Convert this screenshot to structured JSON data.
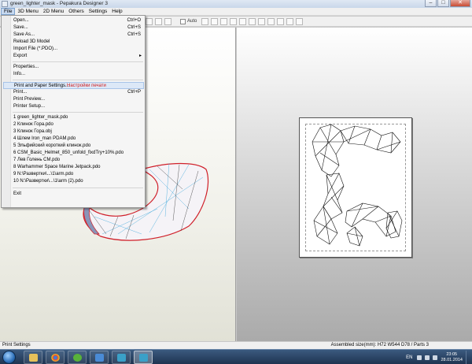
{
  "window": {
    "title": "green_lighter_mask - Pepakura Designer 3"
  },
  "menubar": [
    "File",
    "3D Menu",
    "2D Menu",
    "Others",
    "Settings",
    "Help"
  ],
  "toolbar": {
    "auto_label": "Auto"
  },
  "file_menu": {
    "groups": [
      [
        {
          "label": "Open...",
          "shortcut": "Ctrl+O"
        },
        {
          "label": "Save...",
          "shortcut": "Ctrl+S"
        },
        {
          "label": "Save As...",
          "shortcut": "Ctrl+S"
        },
        {
          "label": "Reload 3D Model",
          "shortcut": ""
        },
        {
          "label": "Import File (*.PDO)...",
          "shortcut": ""
        },
        {
          "label": "Export",
          "shortcut": "",
          "submenu": true
        }
      ],
      [
        {
          "label": "Properties...",
          "shortcut": ""
        },
        {
          "label": "Info...",
          "shortcut": ""
        }
      ],
      [
        {
          "label": "Print and Paper Settings...",
          "shortcut": "",
          "highlight": true,
          "note": "Настройки печати"
        },
        {
          "label": "Print...",
          "shortcut": "Ctrl+P"
        },
        {
          "label": "Print Preview...",
          "shortcut": ""
        },
        {
          "label": "Printer Setup...",
          "shortcut": ""
        }
      ],
      [
        {
          "label": "1 green_lighter_mask.pdo",
          "shortcut": ""
        },
        {
          "label": "2 Клинок Гора.pdo",
          "shortcut": ""
        },
        {
          "label": "3 Клинок Гора.obj",
          "shortcut": ""
        },
        {
          "label": "4 Шлем Iron_man PDAM.pdo",
          "shortcut": ""
        },
        {
          "label": "5 Эльфийский короткий клинок.pdo",
          "shortcut": ""
        },
        {
          "label": "6 CSM_Basic_Helmet_850_unfold_fixdTry+10%.pdo",
          "shortcut": ""
        },
        {
          "label": "7 Лев Голень CM.pdo",
          "shortcut": ""
        },
        {
          "label": "8 Warhammer Space Marine Jetpack.pdo",
          "shortcut": ""
        },
        {
          "label": "9 N:\\Развертки\\...\\1\\arm.pdo",
          "shortcut": ""
        },
        {
          "label": "10 N:\\Развертки\\...\\1\\arm (2).pdo",
          "shortcut": ""
        }
      ],
      [
        {
          "label": "Exit",
          "shortcut": ""
        }
      ]
    ]
  },
  "statusbar": {
    "left": "Print Settings",
    "right": "Assembled size(mm): H72 W544 D78 / Parts 3"
  },
  "taskbar": {
    "lang": "EN",
    "time": "23:05",
    "date": "28.01.2014"
  },
  "colors": {
    "accent": "#c7d9f0",
    "model_outline": "#d0202a",
    "fold_line": "#4ab0e0"
  },
  "icons": [
    "app-icon",
    "minimize-icon",
    "maximize-icon",
    "close-icon",
    "start-orb-icon",
    "submenu-arrow-icon"
  ]
}
